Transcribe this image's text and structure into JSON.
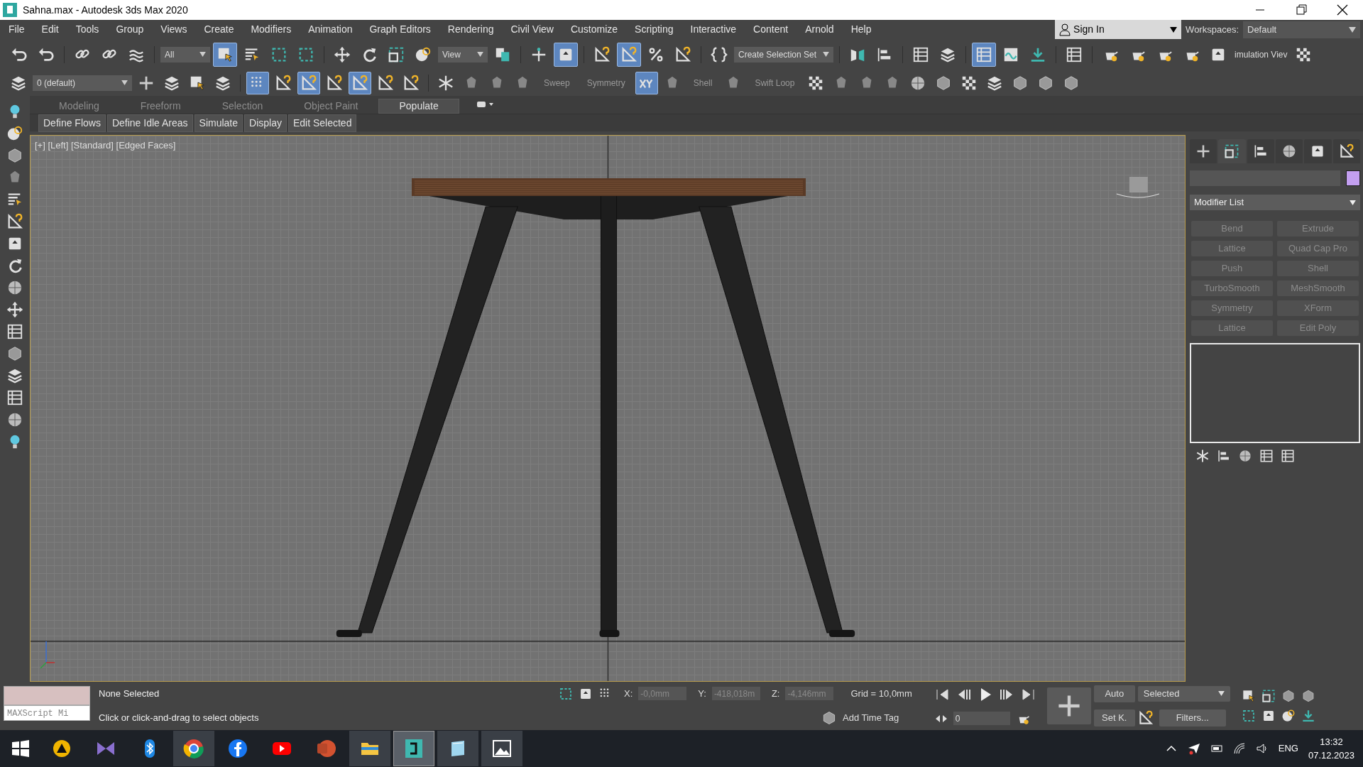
{
  "window": {
    "title": "Sahna.max - Autodesk 3ds Max 2020"
  },
  "menu": [
    "File",
    "Edit",
    "Tools",
    "Group",
    "Views",
    "Create",
    "Modifiers",
    "Animation",
    "Graph Editors",
    "Rendering",
    "Civil View",
    "Customize",
    "Scripting",
    "Interactive",
    "Content",
    "Arnold",
    "Help"
  ],
  "account": {
    "label": "Sign In"
  },
  "workspaces": {
    "label": "Workspaces:",
    "value": "Default"
  },
  "main_toolbar": [
    {
      "kind": "icon",
      "selected": false
    },
    {
      "kind": "icon",
      "selected": false
    },
    {
      "kind": "sep"
    },
    {
      "kind": "icon",
      "selected": false
    },
    {
      "kind": "icon",
      "selected": false
    },
    {
      "kind": "icon",
      "selected": false
    },
    {
      "kind": "sep"
    },
    {
      "kind": "dropdown",
      "text": "All"
    },
    {
      "kind": "icon",
      "selected": true
    },
    {
      "kind": "icon",
      "selected": false
    },
    {
      "kind": "icon",
      "selected": false
    },
    {
      "kind": "icon",
      "selected": false
    },
    {
      "kind": "sep"
    },
    {
      "kind": "icon",
      "selected": false
    },
    {
      "kind": "icon",
      "selected": false
    },
    {
      "kind": "icon",
      "selected": false
    },
    {
      "kind": "icon",
      "selected": false
    },
    {
      "kind": "dropdown",
      "text": "View"
    },
    {
      "kind": "icon",
      "selected": false
    },
    {
      "kind": "sep"
    },
    {
      "kind": "icon",
      "selected": false
    },
    {
      "kind": "icon",
      "selected": true
    },
    {
      "kind": "sep"
    },
    {
      "kind": "icon",
      "selected": false
    },
    {
      "kind": "icon",
      "selected": true
    },
    {
      "kind": "icon",
      "selected": false
    },
    {
      "kind": "icon",
      "selected": false
    },
    {
      "kind": "sep"
    },
    {
      "kind": "icon",
      "selected": false
    },
    {
      "kind": "dropdown",
      "text": "Create Selection Set"
    },
    {
      "kind": "sep"
    },
    {
      "kind": "icon",
      "selected": false
    },
    {
      "kind": "icon",
      "selected": false
    },
    {
      "kind": "sep"
    },
    {
      "kind": "icon",
      "selected": false
    },
    {
      "kind": "icon",
      "selected": false
    },
    {
      "kind": "sep"
    },
    {
      "kind": "icon",
      "selected": true
    },
    {
      "kind": "icon",
      "selected": false
    },
    {
      "kind": "icon",
      "selected": false
    },
    {
      "kind": "sep"
    },
    {
      "kind": "icon",
      "selected": false
    },
    {
      "kind": "sep"
    },
    {
      "kind": "icon",
      "selected": false
    },
    {
      "kind": "icon",
      "selected": false
    },
    {
      "kind": "icon",
      "selected": false
    },
    {
      "kind": "icon",
      "selected": false
    },
    {
      "kind": "icon",
      "selected": false
    },
    {
      "kind": "label",
      "text": "imulation Viev"
    },
    {
      "kind": "icon",
      "selected": false
    }
  ],
  "second_toolbar": [
    {
      "kind": "icon",
      "selected": false
    },
    {
      "kind": "dropdown",
      "text": "0 (default)"
    },
    {
      "kind": "icon",
      "selected": false
    },
    {
      "kind": "icon",
      "selected": false
    },
    {
      "kind": "icon",
      "selected": false
    },
    {
      "kind": "icon",
      "selected": false
    },
    {
      "kind": "sep"
    },
    {
      "kind": "icon",
      "selected": true
    },
    {
      "kind": "icon",
      "selected": false
    },
    {
      "kind": "icon",
      "selected": true
    },
    {
      "kind": "icon",
      "selected": false
    },
    {
      "kind": "icon",
      "selected": true
    },
    {
      "kind": "icon",
      "selected": false
    },
    {
      "kind": "icon",
      "selected": false
    },
    {
      "kind": "sep"
    },
    {
      "kind": "icon",
      "selected": false
    },
    {
      "kind": "icon",
      "selected": false
    },
    {
      "kind": "icon",
      "selected": false
    },
    {
      "kind": "icon",
      "selected": false
    },
    {
      "kind": "label",
      "text": "Sweep"
    },
    {
      "kind": "label",
      "text": "Symmetry"
    },
    {
      "kind": "icon",
      "selected": true
    },
    {
      "kind": "icon",
      "selected": false
    },
    {
      "kind": "label",
      "text": "Shell"
    },
    {
      "kind": "icon",
      "selected": false
    },
    {
      "kind": "label",
      "text": "Swift Loop"
    },
    {
      "kind": "icon",
      "selected": false
    },
    {
      "kind": "icon",
      "selected": false
    },
    {
      "kind": "icon",
      "selected": false
    },
    {
      "kind": "icon",
      "selected": false
    },
    {
      "kind": "icon",
      "selected": false
    },
    {
      "kind": "icon",
      "selected": false
    },
    {
      "kind": "icon",
      "selected": false
    },
    {
      "kind": "icon",
      "selected": false
    },
    {
      "kind": "icon",
      "selected": false
    },
    {
      "kind": "icon",
      "selected": false
    },
    {
      "kind": "icon",
      "selected": false
    }
  ],
  "ribbon": {
    "tabs": [
      {
        "label": "Modeling",
        "selected": false
      },
      {
        "label": "Freeform",
        "selected": false
      },
      {
        "label": "Selection",
        "selected": false
      },
      {
        "label": "Object Paint",
        "selected": false
      },
      {
        "label": "Populate",
        "selected": true
      }
    ],
    "panel_buttons": [
      "Define Flows",
      "Define Idle Areas",
      "Simulate",
      "Display",
      "Edit Selected"
    ]
  },
  "viewport": {
    "label": "[+] [Left] [Standard] [Edged Faces]"
  },
  "command_panel": {
    "tabs": [
      {
        "selected": false
      },
      {
        "selected": true
      },
      {
        "selected": false
      },
      {
        "selected": false
      },
      {
        "selected": false
      },
      {
        "selected": false
      }
    ],
    "modifier_list": "Modifier List",
    "modifiers": [
      "Bend",
      "Extrude",
      "Lattice",
      "Quad Cap Pro",
      "Push",
      "Shell",
      "TurboSmooth",
      "MeshSmooth",
      "Symmetry",
      "XForm",
      "Lattice",
      "Edit Poly"
    ]
  },
  "status": {
    "maxscript": "MAXScript Mi",
    "selection": "None Selected",
    "prompt": "Click or click-and-drag to select objects",
    "coords": [
      {
        "label": "X:",
        "value": "-0,0mm",
        "disabled": true
      },
      {
        "label": "Y:",
        "value": "-418,018m",
        "disabled": true
      },
      {
        "label": "Z:",
        "value": "-4,146mm",
        "disabled": true
      }
    ],
    "grid": "Grid = 10,0mm",
    "time_tag": "Add Time Tag",
    "frame": "0",
    "auto_key": "Auto",
    "set_key": "Set K.",
    "key_filter": "Selected",
    "filters": "Filters..."
  },
  "taskbar": {
    "apps": [
      {
        "running": false,
        "selected": false
      },
      {
        "running": false,
        "selected": false
      },
      {
        "running": false,
        "selected": false
      },
      {
        "running": true,
        "selected": false
      },
      {
        "running": false,
        "selected": false
      },
      {
        "running": false,
        "selected": false
      },
      {
        "running": false,
        "selected": false
      },
      {
        "running": true,
        "selected": false
      },
      {
        "running": true,
        "selected": true
      },
      {
        "running": true,
        "selected": false
      },
      {
        "running": true,
        "selected": false
      }
    ],
    "language": "ENG",
    "time": "13:32",
    "date": "07.12.2023"
  }
}
